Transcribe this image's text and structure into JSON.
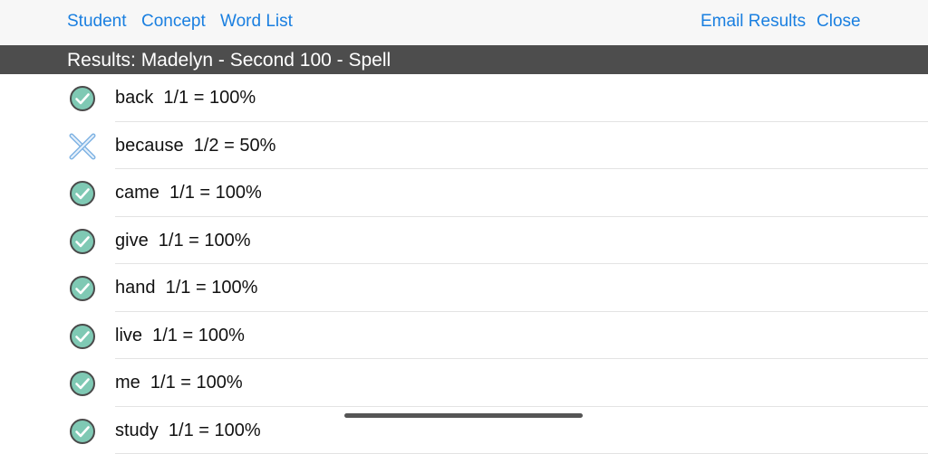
{
  "nav": {
    "left": [
      "Student",
      "Concept",
      "Word List"
    ],
    "email_results": "Email Results",
    "close": "Close"
  },
  "header": {
    "title": "Results: Madelyn - Second 100 - Spell"
  },
  "results": [
    {
      "text": "back  1/1 = 100%",
      "status": "correct",
      "icon": "check-circle-icon"
    },
    {
      "text": "because  1/2 = 50%",
      "status": "incorrect",
      "icon": "x-mark-icon"
    },
    {
      "text": "came  1/1 = 100%",
      "status": "correct",
      "icon": "check-circle-icon"
    },
    {
      "text": "give  1/1 = 100%",
      "status": "correct",
      "icon": "check-circle-icon"
    },
    {
      "text": "hand  1/1 = 100%",
      "status": "correct",
      "icon": "check-circle-icon"
    },
    {
      "text": "live  1/1 = 100%",
      "status": "correct",
      "icon": "check-circle-icon"
    },
    {
      "text": "me  1/1 = 100%",
      "status": "correct",
      "icon": "check-circle-icon"
    },
    {
      "text": "study  1/1 = 100%",
      "status": "correct",
      "icon": "check-circle-icon"
    }
  ],
  "colors": {
    "link": "#1a7fe0",
    "header_bg": "#4d4d4d",
    "check_fill": "#7fc9b4",
    "x_mark": "#a8cdee"
  }
}
